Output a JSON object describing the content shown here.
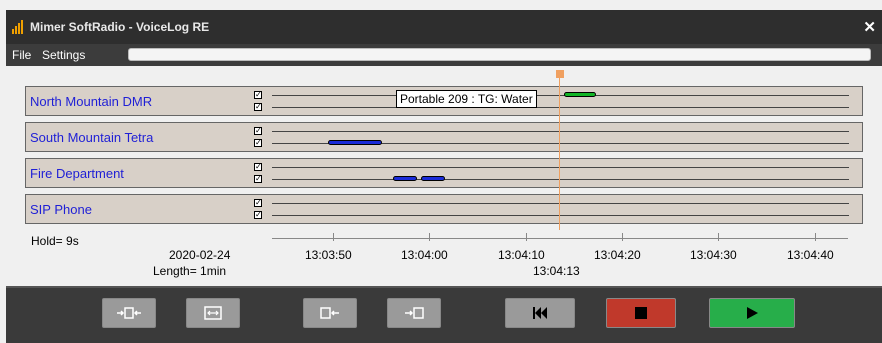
{
  "app": {
    "title": "Mimer SoftRadio - VoiceLog RE"
  },
  "menu": {
    "items": [
      "File",
      "Settings"
    ]
  },
  "tracks": [
    {
      "label": "North Mountain DMR"
    },
    {
      "label": "South Mountain Tetra"
    },
    {
      "label": "Fire Department"
    },
    {
      "label": "SIP Phone"
    }
  ],
  "tooltip": "Portable 209 : TG: Water",
  "hold": "Hold= 9s",
  "date": "2020-02-24",
  "length": "Length= 1min",
  "timeline": {
    "ticks": [
      "13:03:50",
      "13:04:00",
      "13:04:10",
      "13:04:20",
      "13:04:30",
      "13:04:40"
    ],
    "cursor_time": "13:04:13"
  },
  "colors": {
    "accent": "#f0a060",
    "label": "#1f1fd6",
    "seg_blue": "#1a2bd8",
    "seg_green": "#11b526"
  }
}
